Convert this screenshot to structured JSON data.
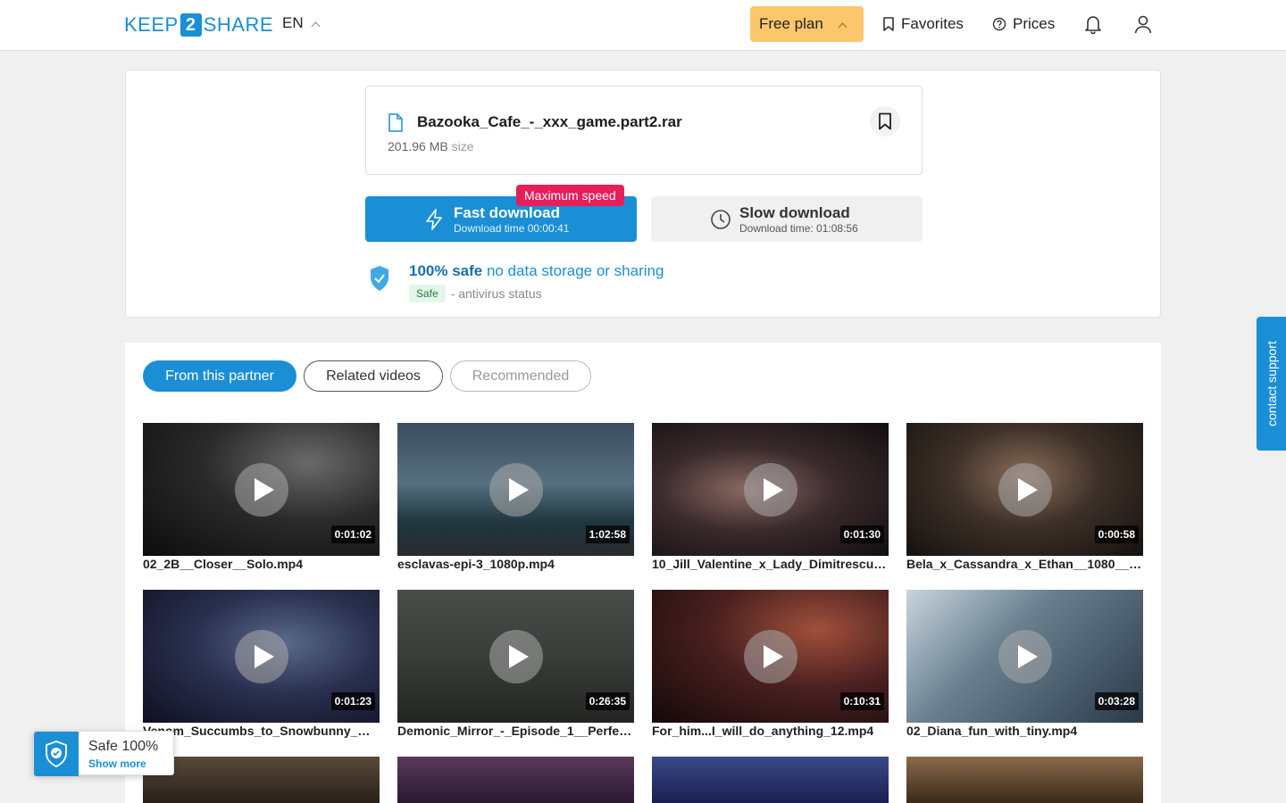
{
  "header": {
    "logo_left": "KEEP",
    "logo_num": "2",
    "logo_right": "SHARE",
    "lang": "EN",
    "plan": "Free plan",
    "favorites": "Favorites",
    "prices": "Prices"
  },
  "file": {
    "name": "Bazooka_Cafe_-_xxx_game.part2.rar",
    "size": "201.96 MB",
    "size_unit": "size"
  },
  "fast": {
    "badge": "Maximum speed",
    "label": "Fast download",
    "time": "Download time 00:00:41"
  },
  "slow": {
    "label": "Slow download",
    "time": "Download time: 01:08:56"
  },
  "safety": {
    "strong": "100% safe",
    "rest": "no data storage or sharing",
    "av_badge": "Safe",
    "av_text": "- antivirus status"
  },
  "tabs": [
    "From this partner",
    "Related videos",
    "Recommended"
  ],
  "videos": [
    {
      "title": "02_2B__Closer__Solo.mp4",
      "duration": "0:01:02"
    },
    {
      "title": "esclavas-epi-3_1080p.mp4",
      "duration": "1:02:58"
    },
    {
      "title": "10_Jill_Valentine_x_Lady_Dimitrescu_…",
      "duration": "0:01:30"
    },
    {
      "title": "Bela_x_Cassandra_x_Ethan__1080___…",
      "duration": "0:00:58"
    },
    {
      "title": "Venom_Succumbs_to_Snowbunny_Min…",
      "duration": "0:01:23"
    },
    {
      "title": "Demonic_Mirror_-_Episode_1__Perfect…",
      "duration": "0:26:35"
    },
    {
      "title": "For_him...I_will_do_anything_12.mp4",
      "duration": "0:10:31"
    },
    {
      "title": "02_Diana_fun_with_tiny.mp4",
      "duration": "0:03:28"
    }
  ],
  "contact_support": "contact support",
  "safe_widget": {
    "title": "Safe 100%",
    "link": "Show more"
  },
  "colors": {
    "accent": "#1a8fd6",
    "plan": "#fcc66c",
    "badge": "#e61e5a"
  }
}
